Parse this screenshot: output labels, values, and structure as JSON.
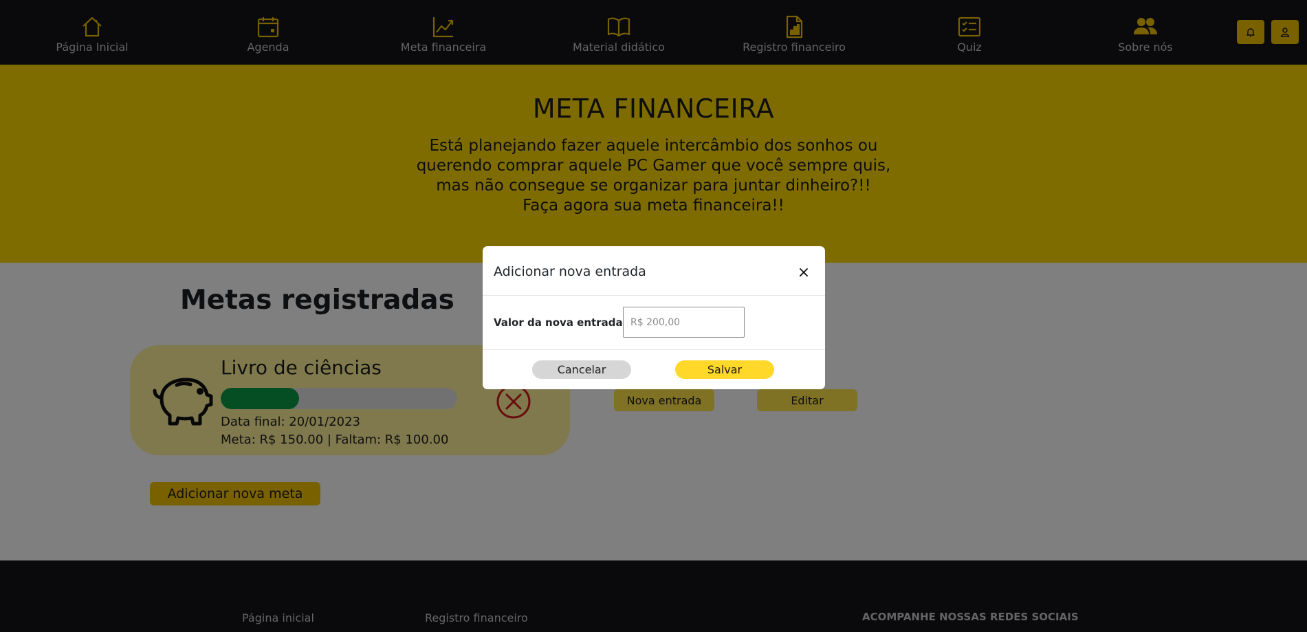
{
  "nav": {
    "items": [
      {
        "label": "Página Inicial",
        "icon": "home-icon"
      },
      {
        "label": "Agenda",
        "icon": "calendar-icon"
      },
      {
        "label": "Meta financeira",
        "icon": "chart-line-icon"
      },
      {
        "label": "Material didático",
        "icon": "book-icon"
      },
      {
        "label": "Registro financeiro",
        "icon": "document-chart-icon"
      },
      {
        "label": "Quiz",
        "icon": "checklist-icon"
      },
      {
        "label": "Sobre nós",
        "icon": "people-icon"
      }
    ],
    "notification_icon": "bell-icon",
    "user_icon": "user-icon"
  },
  "hero": {
    "title": "META FINANCEIRA",
    "lines": [
      "Está planejando fazer aquele intercâmbio dos sonhos ou",
      "querendo comprar aquele PC Gamer que você sempre quis,",
      "mas não consegue se organizar para juntar dinheiro?!!",
      "Faça agora sua meta financeira!!"
    ]
  },
  "main": {
    "heading": "Metas registradas",
    "goal": {
      "title": "Livro de ciências",
      "progress": 0.33,
      "date_line": "Data final: 20/01/2023",
      "meta_line": "Meta: R$ 150.00 | Faltam: R$ 100.00",
      "icon": "piggy-bank-icon",
      "delete_icon": "circle-x-icon"
    },
    "new_entry_label": "Nova entrada",
    "edit_label": "Editar",
    "add_goal_label": "Adicionar nova meta"
  },
  "footer": {
    "links": [
      "Página inicial",
      "Registro financeiro"
    ],
    "social_heading": "ACOMPANHE NOSSAS REDES SOCIAIS"
  },
  "modal": {
    "title": "Adicionar nova entrada",
    "close_symbol": "×",
    "field_label": "Valor da nova entrada:",
    "field_placeholder": "R$ 200,00",
    "cancel_label": "Cancelar",
    "save_label": "Salvar"
  },
  "colors": {
    "nav_bg": "#141518",
    "accent_yellow": "#ffd800",
    "button_yellow": "#f2c300",
    "progress_green": "#0b9c48",
    "delete_red": "#d11a1a"
  }
}
